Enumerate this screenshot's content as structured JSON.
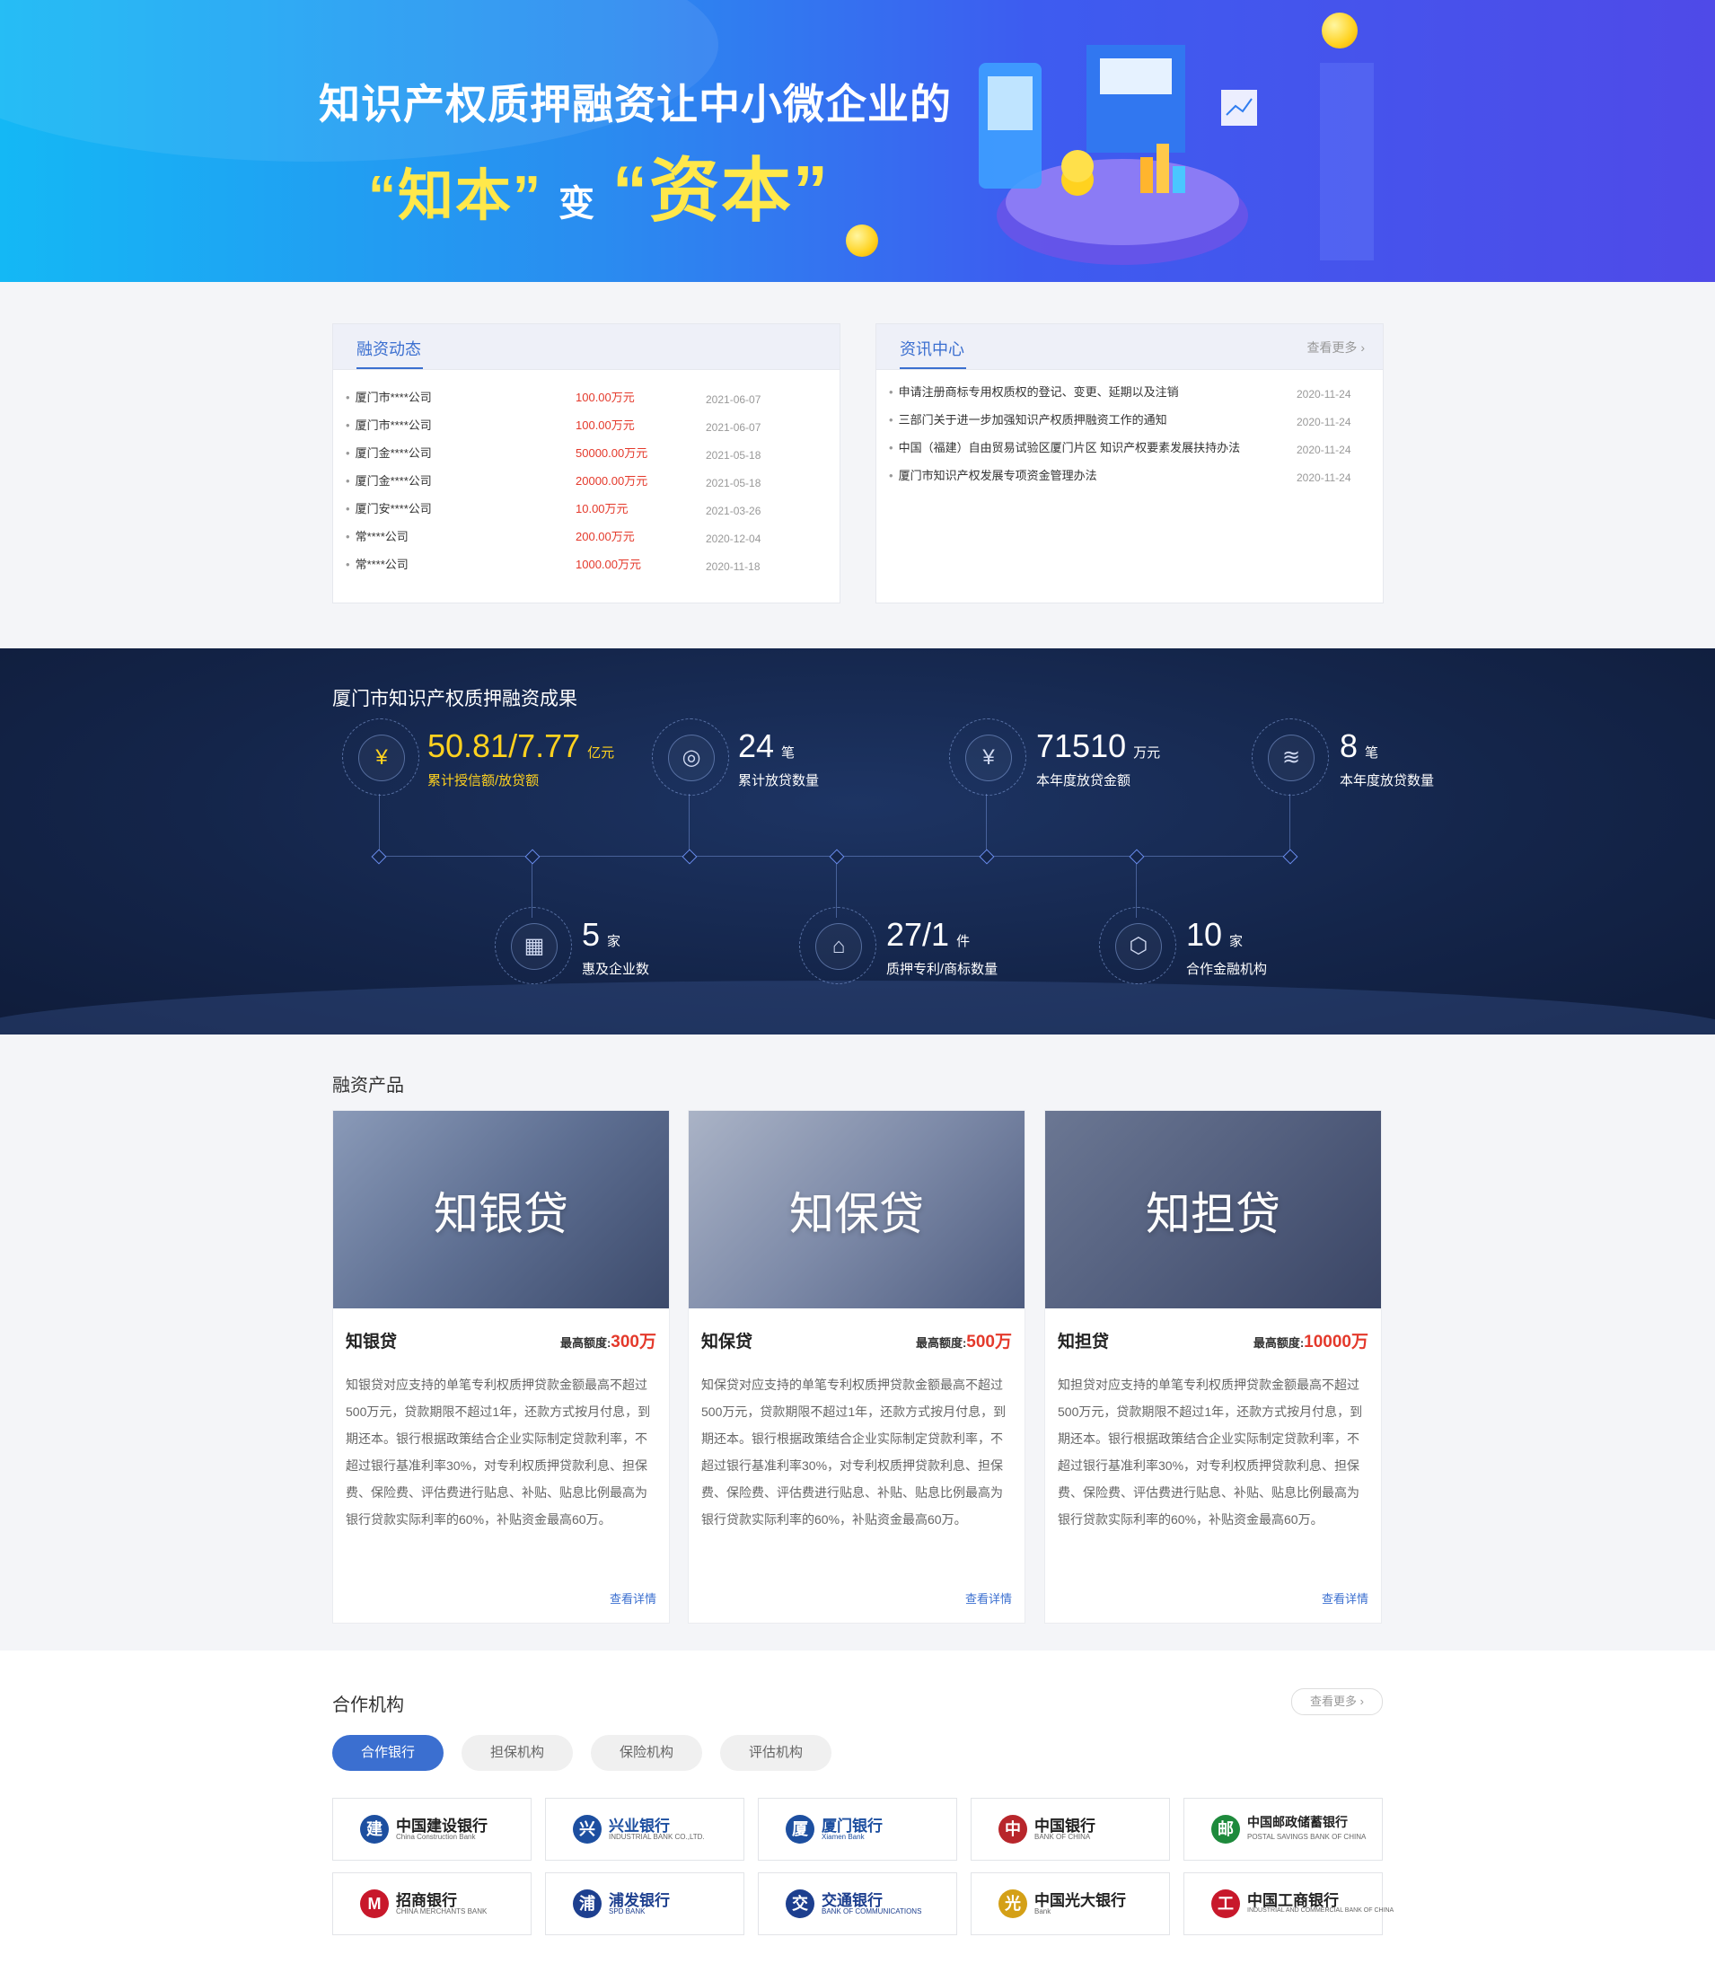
{
  "hero": {
    "line1": "知识产权质押融资让中小微企业的",
    "quote1": "“知本”",
    "bian": "变",
    "quote2": "“资本”"
  },
  "financing_news": {
    "title": "融资动态",
    "rows": [
      {
        "company": "厦门市****公司",
        "amount": "100.00万元",
        "date": "2021-06-07"
      },
      {
        "company": "厦门市****公司",
        "amount": "100.00万元",
        "date": "2021-06-07"
      },
      {
        "company": "厦门金****公司",
        "amount": "50000.00万元",
        "date": "2021-05-18"
      },
      {
        "company": "厦门金****公司",
        "amount": "20000.00万元",
        "date": "2021-05-18"
      },
      {
        "company": "厦门安****公司",
        "amount": "10.00万元",
        "date": "2021-03-26"
      },
      {
        "company": "常****公司",
        "amount": "200.00万元",
        "date": "2020-12-04"
      },
      {
        "company": "常****公司",
        "amount": "1000.00万元",
        "date": "2020-11-18"
      }
    ]
  },
  "info_center": {
    "title": "资讯中心",
    "more": "查看更多",
    "rows": [
      {
        "text": "申请注册商标专用权质权的登记、变更、延期以及注销",
        "date": "2020-11-24"
      },
      {
        "text": "三部门关于进一步加强知识产权质押融资工作的通知",
        "date": "2020-11-24"
      },
      {
        "text": "中国（福建）自由贸易试验区厦门片区 知识产权要素发展扶持办法",
        "date": "2020-11-24"
      },
      {
        "text": "厦门市知识产权发展专项资金管理办法",
        "date": "2020-11-24"
      }
    ]
  },
  "stats": {
    "title": "厦门市知识产权质押融资成果",
    "items": [
      {
        "value": "50.81/7.77",
        "unit": "亿元",
        "label": "累计授信额/放贷额",
        "icon": "money-bag-icon"
      },
      {
        "value": "24",
        "unit": "笔",
        "label": "累计放贷数量",
        "icon": "coins-icon"
      },
      {
        "value": "71510",
        "unit": "万元",
        "label": "本年度放贷金额",
        "icon": "yuan-coin-icon"
      },
      {
        "value": "8",
        "unit": "笔",
        "label": "本年度放贷数量",
        "icon": "layers-icon"
      },
      {
        "value": "5",
        "unit": "家",
        "label": "惠及企业数",
        "icon": "building-icon"
      },
      {
        "value": "27/1",
        "unit": "件",
        "label": "质押专利/商标数量",
        "icon": "seal-icon"
      },
      {
        "value": "10",
        "unit": "家",
        "label": "合作金融机构",
        "icon": "cube-icon"
      }
    ]
  },
  "products": {
    "title": "融资产品",
    "quota_label": "最高额度:",
    "detail": "查看详情",
    "items": [
      {
        "name": "知银贷",
        "quota": "300万",
        "desc": "知银贷对应支持的单笔专利权质押贷款金额最高不超过500万元，贷款期限不超过1年，还款方式按月付息，到期还本。银行根据政策结合企业实际制定贷款利率，不超过银行基准利率30%，对专利权质押贷款利息、担保费、保险费、评估费进行贴息、补贴、贴息比例最高为银行贷款实际利率的60%，补贴资金最高60万。"
      },
      {
        "name": "知保贷",
        "quota": "500万",
        "desc": "知保贷对应支持的单笔专利权质押贷款金额最高不超过500万元，贷款期限不超过1年，还款方式按月付息，到期还本。银行根据政策结合企业实际制定贷款利率，不超过银行基准利率30%，对专利权质押贷款利息、担保费、保险费、评估费进行贴息、补贴、贴息比例最高为银行贷款实际利率的60%，补贴资金最高60万。"
      },
      {
        "name": "知担贷",
        "quota": "10000万",
        "desc": "知担贷对应支持的单笔专利权质押贷款金额最高不超过500万元，贷款期限不超过1年，还款方式按月付息，到期还本。银行根据政策结合企业实际制定贷款利率，不超过银行基准利率30%，对专利权质押贷款利息、担保费、保险费、评估费进行贴息、补贴、贴息比例最高为银行贷款实际利率的60%，补贴资金最高60万。"
      }
    ]
  },
  "partners": {
    "title": "合作机构",
    "more": "查看更多",
    "tabs": [
      "合作银行",
      "担保机构",
      "保险机构",
      "评估机构"
    ],
    "banks": [
      {
        "cn": "中国建设银行",
        "en": "China Construction Bank",
        "mark": "建",
        "color": "#1d4fa0"
      },
      {
        "cn": "兴业银行",
        "en": "INDUSTRIAL BANK CO.,LTD.",
        "mark": "兴",
        "color": "#1d4fa0"
      },
      {
        "cn": "厦门银行",
        "en": "Xiamen Bank",
        "mark": "厦",
        "color": "#1d4fa0"
      },
      {
        "cn": "中国银行",
        "en": "BANK OF CHINA",
        "mark": "中",
        "color": "#b8262b"
      },
      {
        "cn": "中国邮政储蓄银行",
        "en": "POSTAL SAVINGS BANK OF CHINA",
        "mark": "邮",
        "color": "#1e8a3c"
      },
      {
        "cn": "招商银行",
        "en": "CHINA MERCHANTS BANK",
        "mark": "M",
        "color": "#c8182b"
      },
      {
        "cn": "浦发银行",
        "en": "SPD BANK",
        "mark": "浦",
        "color": "#1d3f8f"
      },
      {
        "cn": "交通银行",
        "en": "BANK OF COMMUNICATIONS",
        "mark": "交",
        "color": "#1d3f8f"
      },
      {
        "cn": "中国光大银行",
        "en": "Bank",
        "mark": "光",
        "color": "#d4a017"
      },
      {
        "cn": "中国工商银行",
        "en": "INDUSTRIAL AND COMMERCIAL BANK OF CHINA",
        "mark": "工",
        "color": "#c8182b"
      }
    ]
  }
}
